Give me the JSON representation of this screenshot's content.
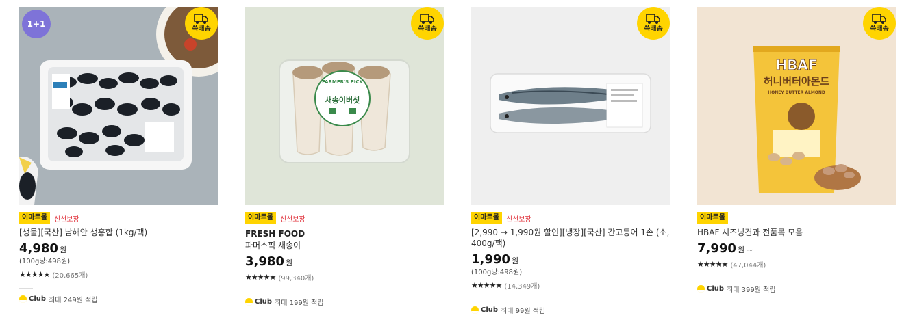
{
  "products": [
    {
      "badge": "1+1",
      "shipping": "쓱배송",
      "mall_tag": "이마트몰",
      "fresh_tag": "신선보장",
      "brand": "",
      "title": "[생물][국산] 남해안 생홍합 (1kg/팩)",
      "price": "4,980",
      "currency": "원",
      "unit_price": "(100g당:498원)",
      "stars": "★★★★★",
      "reviews": "(20,665개)",
      "club_label": "Club",
      "club_text": "최대 249원 적립"
    },
    {
      "badge": "",
      "shipping": "쓱배송",
      "mall_tag": "이마트몰",
      "fresh_tag": "신선보장",
      "brand": "FRESH FOOD",
      "title": "파머스픽 새송이",
      "price": "3,980",
      "currency": "원",
      "unit_price": "",
      "stars": "★★★★★",
      "reviews": "(99,340개)",
      "club_label": "Club",
      "club_text": "최대 199원 적립"
    },
    {
      "badge": "",
      "shipping": "쓱배송",
      "mall_tag": "이마트몰",
      "fresh_tag": "신선보장",
      "brand": "",
      "title": "[2,990 → 1,990원 할인][냉장][국산] 간고등어 1손 (소, 400g/팩)",
      "price": "1,990",
      "currency": "원",
      "unit_price": "(100g당:498원)",
      "stars": "★★★★★",
      "reviews": "(14,349개)",
      "club_label": "Club",
      "club_text": "최대 99원 적립"
    },
    {
      "badge": "",
      "shipping": "쓱배송",
      "mall_tag": "이마트몰",
      "fresh_tag": "",
      "brand": "",
      "title": "HBAF 시즈닝견과 전품목 모음",
      "price": "7,990",
      "currency": "원 ~",
      "unit_price": "",
      "stars": "★★★★★",
      "reviews": "(47,044개)",
      "club_label": "Club",
      "club_text": "최대 399원 적립"
    }
  ],
  "images": {
    "mushroom_label": "새송이버섯",
    "mushroom_brand": "FARMER'S PICK",
    "nuts_brand": "HBAF",
    "nuts_name": "허니버터아몬드",
    "nuts_sub": "HONEY BUTTER ALMOND"
  },
  "colors": {
    "accent_yellow": "#ffd400",
    "badge_purple": "#7e73d8",
    "fresh_red": "#e0303a"
  }
}
